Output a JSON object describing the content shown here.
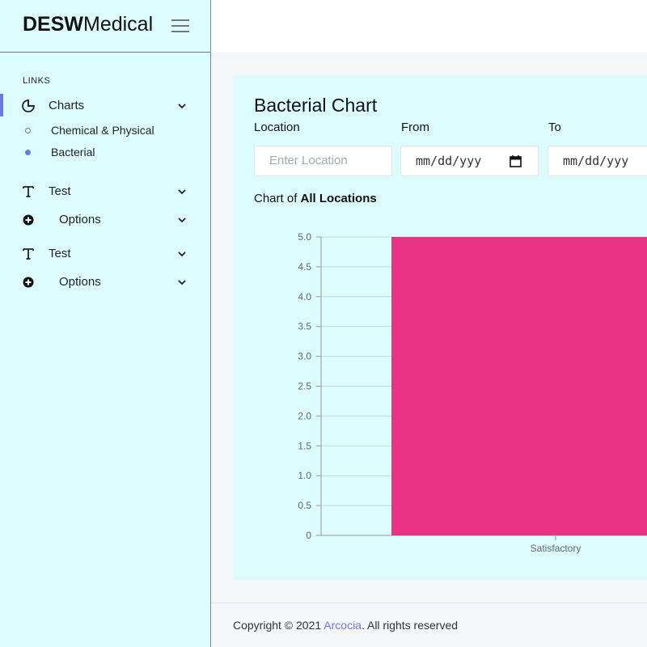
{
  "brand": {
    "bold": "DESW",
    "regular": "Medical"
  },
  "sidebar": {
    "section_title": "LINKS",
    "charts_label": "Charts",
    "sub_items": [
      {
        "label": "Chemical & Physical",
        "state": "inactive"
      },
      {
        "label": "Bacterial",
        "state": "active"
      }
    ],
    "groups": [
      {
        "test_label": "Test",
        "options_label": "Options"
      },
      {
        "test_label": "Test",
        "options_label": "Options"
      }
    ]
  },
  "card": {
    "title": "Bacterial Chart",
    "location_label": "Location",
    "location_placeholder": "Enter Location",
    "from_label": "From",
    "from_value": "mm/dd/yyy",
    "to_label": "To",
    "to_value": "mm/dd/yyy",
    "caption_prefix": "Chart of ",
    "caption_bold": "All Locations"
  },
  "chart_data": {
    "type": "bar",
    "categories": [
      "Satisfactory"
    ],
    "values": [
      5
    ],
    "ylim": [
      0,
      5
    ],
    "yticks": [
      "0",
      "0.5",
      "1.0",
      "1.5",
      "2.0",
      "2.5",
      "3.0",
      "3.5",
      "4.0",
      "4.5",
      "5.0"
    ],
    "bar_color": "#e83385",
    "grid": true
  },
  "footer": {
    "prefix": "Copyright © 2021 ",
    "link": "Arcocia",
    "suffix": ". All rights reserved"
  },
  "colors": {
    "sidebar_bg": "#dcfcfd",
    "accent": "#6c7ae0",
    "bar": "#e83385"
  }
}
